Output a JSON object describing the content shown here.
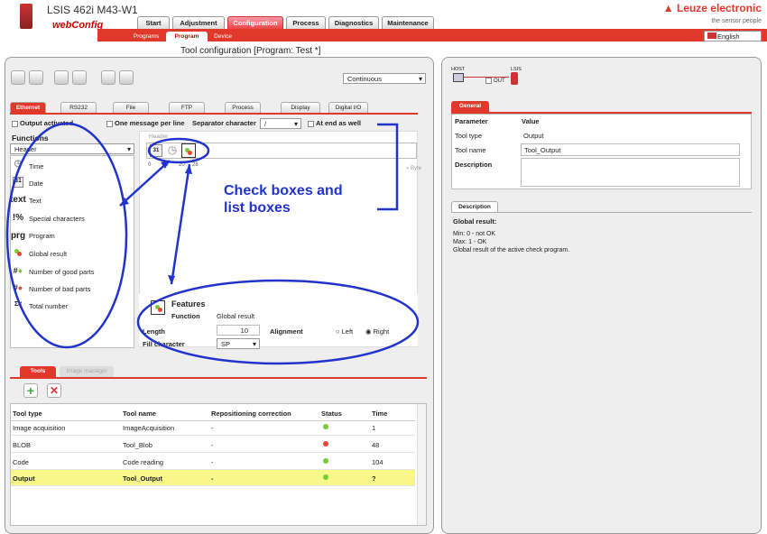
{
  "header": {
    "product": "LSIS 462i M43-W1",
    "webconfig": "webConfig",
    "brand": "Leuze electronic",
    "slogan": "the sensor people",
    "language": "English",
    "main_tabs": [
      "Start",
      "Adjustment",
      "Configuration",
      "Process",
      "Diagnostics",
      "Maintenance"
    ],
    "sub_tabs": [
      "Programs",
      "Program",
      "Device"
    ]
  },
  "title": "Tool configuration   [Program: Test *]",
  "toolbar": {
    "mode": "Continuous"
  },
  "interface_tabs": [
    "Ethernet",
    "RS232",
    "File",
    "FTP",
    "Process",
    "Display",
    "Digital I/O"
  ],
  "options": {
    "output_activated": "Output activated",
    "one_message": "One message per line",
    "separator_label": "Separator character",
    "separator_value": "/",
    "at_end": "At end as well"
  },
  "functions": {
    "heading": "Functions",
    "filter": "Header",
    "items": [
      {
        "icon": "clock-icon",
        "label": "Time"
      },
      {
        "icon": "calendar-icon",
        "label": "Date"
      },
      {
        "icon": "text",
        "label": "Text"
      },
      {
        "icon": "special-icon",
        "label": "Special characters"
      },
      {
        "icon": "program-icon",
        "label": "Program"
      },
      {
        "icon": "global-result-icon",
        "label": "Global result"
      },
      {
        "icon": "good-parts-icon",
        "label": "Number of good parts"
      },
      {
        "icon": "bad-parts-icon",
        "label": "Number of bad parts"
      },
      {
        "icon": "total-icon",
        "label": "Total number"
      }
    ],
    "icon_text": {
      "text": "text",
      "special": "!%",
      "program": "prg",
      "calendar": "31",
      "total": "Σ#"
    }
  },
  "header_area": {
    "label": "Header",
    "ruler": [
      "0",
      "10",
      "20",
      "28"
    ],
    "unit": "Byte"
  },
  "annotation": {
    "line1": "Check boxes and",
    "line2": "list boxes"
  },
  "features": {
    "heading": "Features",
    "function_label": "Function",
    "function_value": "Global result",
    "length_label": "Length",
    "length_value": "10",
    "alignment_label": "Alignment",
    "left": "Left",
    "right": "Right",
    "fill_label": "Fill character",
    "fill_value": "SP"
  },
  "tools_tabs": [
    "Tools",
    "Image manager"
  ],
  "tools_table": {
    "headers": [
      "Tool type",
      "Tool name",
      "Repositioning correction",
      "Status",
      "Time"
    ],
    "rows": [
      {
        "type": "Image acquisition",
        "name": "ImageAcquisition",
        "repo": "-",
        "status": "#7c3",
        "time": "1"
      },
      {
        "type": "BLOB",
        "name": "Tool_Blob",
        "repo": "-",
        "status": "#e43",
        "time": "48"
      },
      {
        "type": "Code",
        "name": "Code reading",
        "repo": "-",
        "status": "#7c3",
        "time": "104"
      },
      {
        "type": "Output",
        "name": "Tool_Output",
        "repo": "-",
        "status": "#7c3",
        "time": "?"
      }
    ]
  },
  "connection": {
    "host": "HOST",
    "lsis": "LSIS",
    "out": "OUT"
  },
  "general": {
    "tab": "General",
    "col_param": "Parameter",
    "col_value": "Value",
    "tool_type_label": "Tool type",
    "tool_type_value": "Output",
    "tool_name_label": "Tool name",
    "tool_name_value": "Tool_Output",
    "description_label": "Description"
  },
  "description": {
    "tab": "Description",
    "heading": "Global result:",
    "line1": "Min: 0 - not OK",
    "line2": "Max: 1 - OK",
    "line3": "Global result of the active check program."
  }
}
